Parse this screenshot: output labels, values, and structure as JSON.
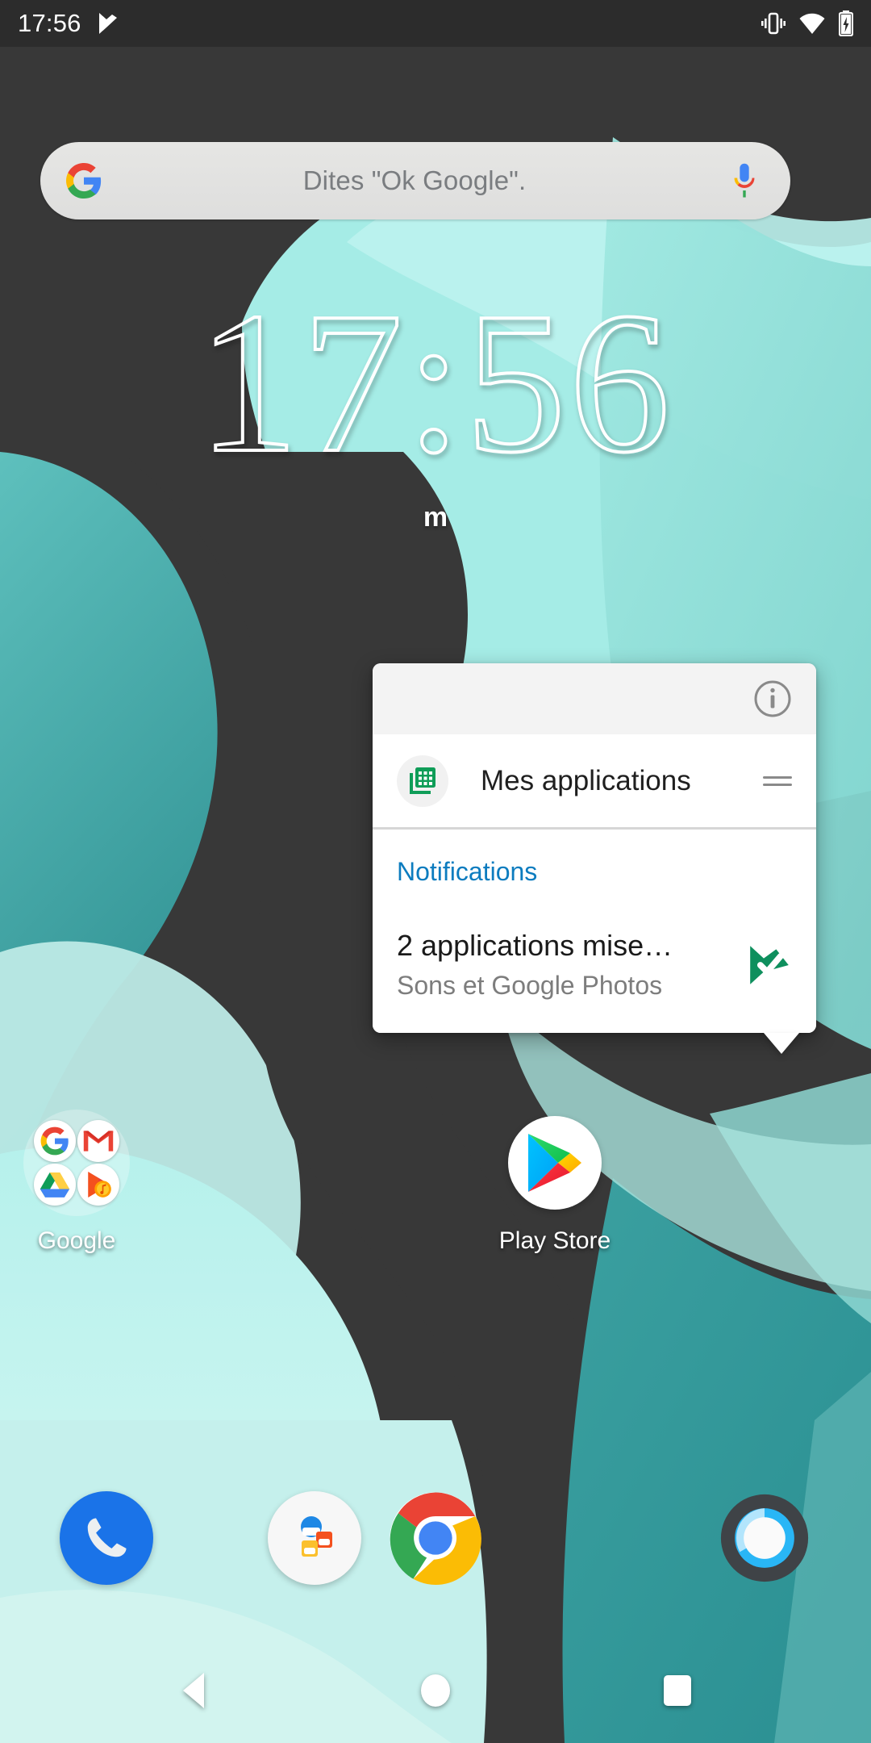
{
  "status_bar": {
    "time": "17:56",
    "left_icons": [
      "play-store-update-icon"
    ],
    "right_icons": [
      "vibrate-icon",
      "wifi-icon",
      "battery-charging-icon"
    ]
  },
  "search_widget": {
    "logo": "google-g-icon",
    "hint": "Dites \"Ok Google\".",
    "mic": "google-mic-icon"
  },
  "clock_widget": {
    "time": "17:56",
    "date": "m"
  },
  "popup": {
    "info_icon": "info-icon",
    "shortcut": {
      "icon": "my-apps-grid-icon",
      "label": "Mes applications",
      "handle": "drag-handle-icon"
    },
    "notifications": {
      "title": "Notifications",
      "items": [
        {
          "title": "2 applications mise…",
          "subtitle": "Sons et Google Photos",
          "icon": "play-store-update-check-icon"
        }
      ]
    }
  },
  "home_icons": [
    {
      "name": "google-folder",
      "label": "Google",
      "type": "folder",
      "contents": [
        "google-g-icon",
        "gmail-icon",
        "drive-icon",
        "play-music-icon"
      ]
    },
    {
      "name": "play-store",
      "label": "Play Store",
      "type": "app",
      "icon": "play-store-icon"
    }
  ],
  "dock": [
    {
      "name": "phone",
      "icon": "phone-icon"
    },
    {
      "name": "contacts-folder",
      "icon": "contacts-folder-icon"
    },
    {
      "name": "chrome",
      "icon": "chrome-icon"
    },
    {
      "name": "camera",
      "icon": "camera-icon"
    }
  ],
  "nav_bar": {
    "back": "back-triangle-icon",
    "home": "home-circle-icon",
    "recents": "recents-square-icon"
  },
  "colors": {
    "status_bar_bg": "#2c2c2c",
    "wallpaper_dark": "#383838",
    "wallpaper_teal": "#7ecfc9",
    "wallpaper_light": "#cdf5f2",
    "popup_bg": "#ffffff",
    "notif_title": "#0c7cbf",
    "accent_green": "#0f9d58"
  }
}
